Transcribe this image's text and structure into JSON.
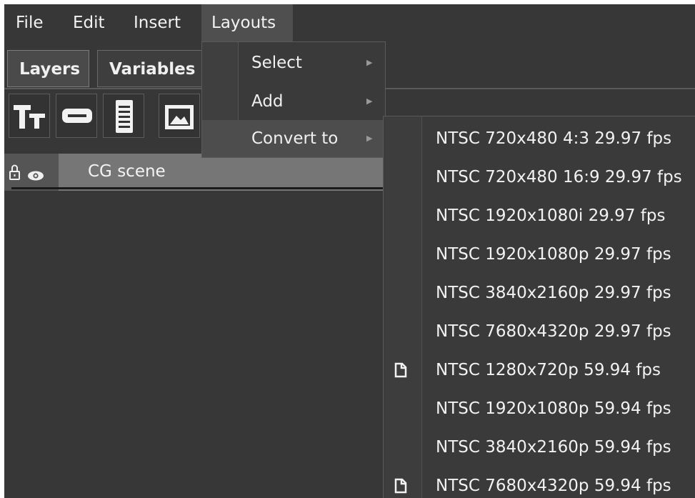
{
  "menubar": {
    "items": [
      {
        "label": "File"
      },
      {
        "label": "Edit"
      },
      {
        "label": "Insert"
      },
      {
        "label": "Layouts"
      }
    ]
  },
  "tabs": [
    {
      "label": "Layers"
    },
    {
      "label": "Variables"
    }
  ],
  "toolbar": {
    "tools": [
      {
        "icon": "text-icon"
      },
      {
        "icon": "button-shape-icon"
      },
      {
        "icon": "document-list-icon"
      },
      {
        "icon": "image-icon"
      }
    ]
  },
  "layers": {
    "row": {
      "name": "CG scene",
      "lock_icon": "lock-icon",
      "visibility_icon": "eye-icon"
    }
  },
  "layouts_menu": {
    "items": [
      {
        "label": "Select",
        "has_submenu": true
      },
      {
        "label": "Add",
        "has_submenu": true
      },
      {
        "label": "Convert to",
        "has_submenu": true,
        "highlighted": true
      }
    ]
  },
  "convert_submenu": {
    "items": [
      {
        "label": "NTSC 720x480 4:3 29.97 fps",
        "icon": ""
      },
      {
        "label": "NTSC 720x480 16:9 29.97 fps",
        "icon": ""
      },
      {
        "label": "NTSC 1920x1080i 29.97 fps",
        "icon": ""
      },
      {
        "label": "NTSC 1920x1080p 29.97 fps",
        "icon": ""
      },
      {
        "label": "NTSC 3840x2160p 29.97 fps",
        "icon": ""
      },
      {
        "label": "NTSC 7680x4320p 29.97 fps",
        "icon": ""
      },
      {
        "label": "NTSC 1280x720p 59.94 fps",
        "icon": "document-icon"
      },
      {
        "label": "NTSC 1920x1080p 59.94 fps",
        "icon": ""
      },
      {
        "label": "NTSC 3840x2160p 59.94 fps",
        "icon": ""
      },
      {
        "label": "NTSC 7680x4320p 59.94 fps",
        "icon": "document-icon"
      }
    ]
  },
  "colors": {
    "background": "#373737",
    "menu_active": "#4f4f4f",
    "layer_row": "#767676",
    "text": "#f0f0f0"
  }
}
